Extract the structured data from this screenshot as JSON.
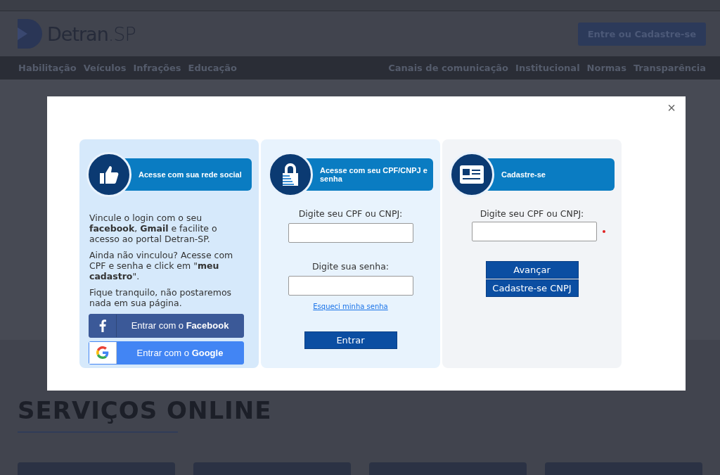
{
  "header": {
    "logo": {
      "name": "Detran",
      "suffix": ".SP"
    },
    "login_button": "Entre ou Cadastre-se"
  },
  "nav": {
    "left": [
      "Habilitação",
      "Veículos",
      "Infrações",
      "Educação"
    ],
    "right": [
      "Canais de comunicação",
      "Institucional",
      "Normas",
      "Transparência"
    ]
  },
  "section_title": "SERVIÇOS ONLINE",
  "modal": {
    "close": "×",
    "social": {
      "title": "Acesse com sua rede social",
      "paragraphs": [
        "Vincule o login com o seu **facebook**, **Gmail** e facilite o acesso ao portal Detran-SP.",
        "Ainda não vinculou? Acesse com CPF e senha e click em \"**meu cadastro**\".",
        "Fique tranquilo, não postaremos nada em sua página."
      ],
      "buttons": [
        {
          "kind": "facebook",
          "label": "Entrar com o **Facebook**"
        },
        {
          "kind": "google",
          "label": "Entrar com o **Google**"
        }
      ]
    },
    "login": {
      "title": "Acesse com seu CPF/CNPJ e senha",
      "cpf_label": "Digite seu CPF ou CNPJ:",
      "password_label": "Digite sua senha:",
      "forgot_link": "Esqueci minha senha",
      "submit": "Entrar"
    },
    "register": {
      "title": "Cadastre-se",
      "cpf_label": "Digite seu CPF ou CNPJ:",
      "required": true,
      "buttons": [
        "Avançar",
        "Cadastre-se CNPJ"
      ]
    }
  }
}
